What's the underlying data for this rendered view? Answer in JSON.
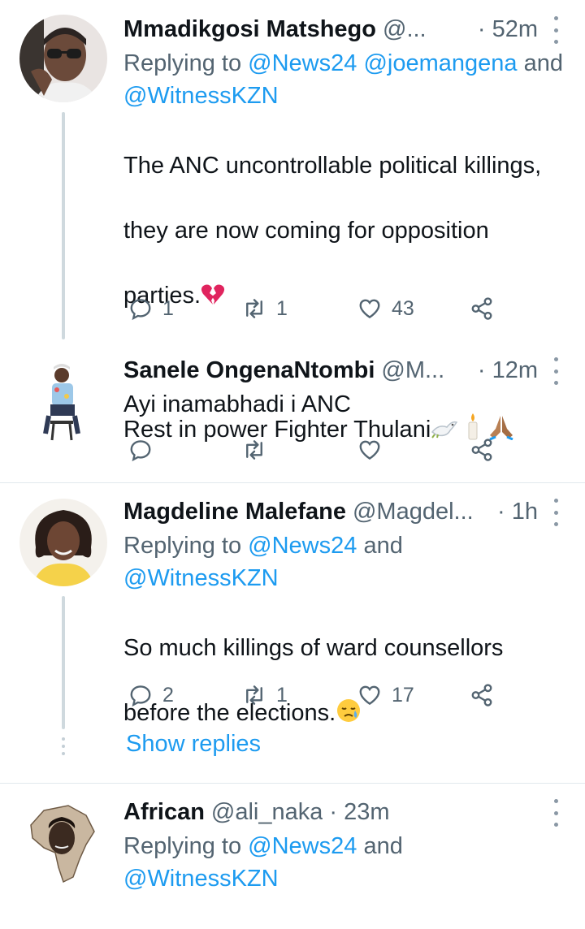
{
  "tweets": [
    {
      "name": "Mmadikgosi Matshego",
      "handle": "@...",
      "time": "· 52m",
      "replying_label": "Replying to",
      "mentions": [
        "@News24",
        "@joemangena"
      ],
      "and_label": "and",
      "mention_last": "@WitnessKZN",
      "text_line1": "The ANC uncontrollable political killings,",
      "text_line2": "they are now coming for opposition",
      "text_line3": "parties.",
      "text_line4": "Rest in power Fighter Thulani",
      "replies": "1",
      "retweets": "1",
      "likes": "43"
    },
    {
      "name": "Sanele OngenaNtombi",
      "handle": "@M...",
      "time": "· 12m",
      "text": "Ayi inamabhadi i ANC",
      "replies": "",
      "retweets": "",
      "likes": ""
    },
    {
      "name": "Magdeline Malefane",
      "handle": "@Magdel...",
      "time": "· 1h",
      "replying_label": "Replying to",
      "mention_first": "@News24",
      "and_label": "and",
      "mention_last": "@WitnessKZN",
      "text_line1": "So much killings of ward counsellors",
      "text_line2": "before the elections.",
      "replies": "2",
      "retweets": "1",
      "likes": "17",
      "show_replies": "Show replies"
    },
    {
      "name": "African",
      "handle": "@ali_naka",
      "time": "· 23m",
      "replying_label": "Replying to",
      "mention_first": "@News24",
      "and_label": "and",
      "mention_last": "@WitnessKZN"
    }
  ],
  "colors": {
    "link": "#1d9bf0",
    "muted": "#536471",
    "text": "#0f1419",
    "heart_broken": "#e0245e"
  },
  "icons": [
    "reply-icon",
    "retweet-icon",
    "like-icon",
    "share-icon",
    "more-icon",
    "broken-heart-icon",
    "dove-icon",
    "candle-icon",
    "praying-hands-icon",
    "crying-face-icon"
  ]
}
